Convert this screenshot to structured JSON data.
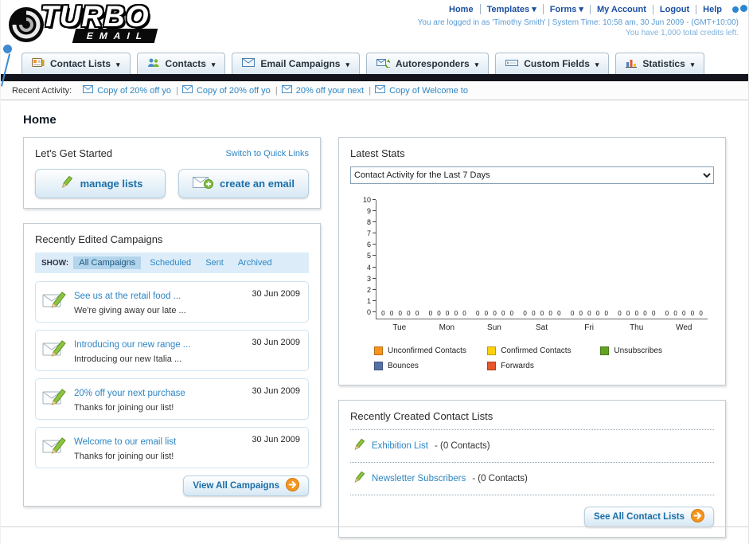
{
  "header": {
    "logo": {
      "title": "TURBO",
      "subtitle": "EMAIL"
    },
    "links": [
      "Home",
      "Templates ▾",
      "Forms ▾",
      "My Account",
      "Logout",
      "Help"
    ],
    "login_info": "You are logged in as 'Timothy Smith' | System Time: 10:58 am, 30 Jun 2009 - (GMT+10:00)",
    "credits_info": "You have 1,000 total credits left."
  },
  "nav": {
    "tabs": [
      {
        "label": "Contact Lists"
      },
      {
        "label": "Contacts"
      },
      {
        "label": "Email Campaigns"
      },
      {
        "label": "Autoresponders"
      },
      {
        "label": "Custom Fields"
      },
      {
        "label": "Statistics"
      }
    ]
  },
  "activity": {
    "label": "Recent Activity:",
    "items": [
      {
        "label": "Copy of 20% off yo"
      },
      {
        "label": "Copy of 20% off yo"
      },
      {
        "label": "20% off your next"
      },
      {
        "label": "Copy of Welcome to"
      }
    ]
  },
  "page": {
    "title": "Home"
  },
  "get_started": {
    "title": "Let's Get Started",
    "switch_link": "Switch to Quick Links",
    "manage_lists_label": "manage lists",
    "create_email_label": "create an email"
  },
  "campaigns": {
    "title": "Recently Edited Campaigns",
    "show_label": "SHOW:",
    "filters": [
      {
        "label": "All Campaigns",
        "selected": true
      },
      {
        "label": "Scheduled"
      },
      {
        "label": "Sent"
      },
      {
        "label": "Archived"
      }
    ],
    "items": [
      {
        "title": "See us at the retail food ...",
        "subtitle": "We're giving away our late ...",
        "date": "30 Jun 2009"
      },
      {
        "title": "Introducing our new range ...",
        "subtitle": "Introducing our new Italia ...",
        "date": "30 Jun 2009"
      },
      {
        "title": "20% off your next purchase",
        "subtitle": "Thanks for joining our list!",
        "date": "30 Jun 2009"
      },
      {
        "title": "Welcome to our email list",
        "subtitle": "Thanks for joining our list!",
        "date": "30 Jun 2009"
      }
    ],
    "view_all_label": "View All Campaigns"
  },
  "stats": {
    "title": "Latest Stats",
    "dropdown_value": "Contact Activity for the Last 7 Days",
    "chart_data": {
      "type": "bar",
      "title": "Contact Activity for the Last 7 Days",
      "categories": [
        "Tue",
        "Mon",
        "Sun",
        "Sat",
        "Fri",
        "Thu",
        "Wed"
      ],
      "series": [
        {
          "name": "Unconfirmed Contacts",
          "color": "#f7941d",
          "values": [
            0,
            0,
            0,
            0,
            0,
            0,
            0
          ]
        },
        {
          "name": "Confirmed Contacts",
          "color": "#fed10a",
          "values": [
            0,
            0,
            0,
            0,
            0,
            0,
            0
          ]
        },
        {
          "name": "Unsubscribes",
          "color": "#61a424",
          "values": [
            0,
            0,
            0,
            0,
            0,
            0,
            0
          ]
        },
        {
          "name": "Bounces",
          "color": "#5571a7",
          "values": [
            0,
            0,
            0,
            0,
            0,
            0,
            0
          ]
        },
        {
          "name": "Forwards",
          "color": "#e8542c",
          "values": [
            0,
            0,
            0,
            0,
            0,
            0,
            0
          ]
        }
      ],
      "ylim": [
        0,
        10
      ],
      "ytick_step": 1,
      "grid": false,
      "legend_position": "bottom"
    }
  },
  "contact_lists": {
    "title": "Recently Created Contact Lists",
    "items": [
      {
        "name": "Exhibition List",
        "detail": "- (0 Contacts)"
      },
      {
        "name": "Newsletter Subscribers",
        "detail": "- (0 Contacts)"
      }
    ],
    "see_all_label": "See All Contact Lists"
  }
}
